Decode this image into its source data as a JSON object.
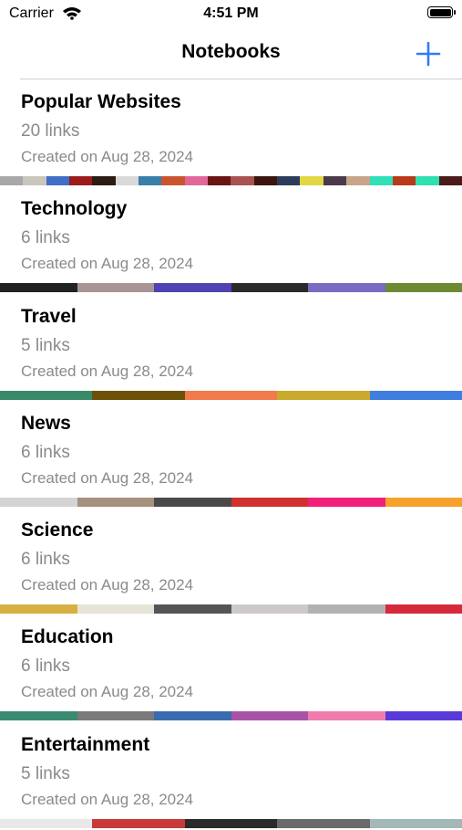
{
  "status_bar": {
    "carrier": "Carrier",
    "time": "4:51 PM"
  },
  "nav": {
    "title": "Notebooks",
    "add_icon": "plus-icon",
    "accent_color": "#2f7cf6"
  },
  "notebooks": [
    {
      "name": "Popular Websites",
      "links": "20 links",
      "created": "Created on Aug 28, 2024",
      "colors": [
        "#a8a8a8",
        "#c9c6be",
        "#3f6fc6",
        "#9b1c1a",
        "#2b1c14",
        "#d9d9d9",
        "#3a7fa8",
        "#c9552f",
        "#e2679a",
        "#6b1512",
        "#a85252",
        "#3d1510",
        "#2b3d5a",
        "#e1d744",
        "#4a3a4a",
        "#c8a48a",
        "#2fe0b8",
        "#b83a1a",
        "#2fe0b0",
        "#4b1a1a"
      ]
    },
    {
      "name": "Technology",
      "links": "6 links",
      "created": "Created on Aug 28, 2024",
      "colors": [
        "#222222",
        "#a89494",
        "#4f42b2",
        "#2a2a2a",
        "#7a6ac2",
        "#6c8a32"
      ]
    },
    {
      "name": "Travel",
      "links": "5 links",
      "created": "Created on Aug 28, 2024",
      "colors": [
        "#3a8a6a",
        "#6c5208",
        "#f27a4a",
        "#c8aa2c",
        "#3f7ee0"
      ]
    },
    {
      "name": "News",
      "links": "6 links",
      "created": "Created on Aug 28, 2024",
      "colors": [
        "#d4d4d4",
        "#a6907e",
        "#4a4a4a",
        "#d03030",
        "#f0207a",
        "#f6a22a"
      ]
    },
    {
      "name": "Science",
      "links": "6 links",
      "created": "Created on Aug 28, 2024",
      "colors": [
        "#d6b040",
        "#e6e4d6",
        "#555555",
        "#ccc8cc",
        "#b2b2b2",
        "#d62a3c"
      ]
    },
    {
      "name": "Education",
      "links": "6 links",
      "created": "Created on Aug 28, 2024",
      "colors": [
        "#3a8a72",
        "#7a7a7a",
        "#3a6ab0",
        "#a854a6",
        "#f07cae",
        "#5a3ad8"
      ]
    },
    {
      "name": "Entertainment",
      "links": "5 links",
      "created": "Created on Aug 28, 2024",
      "colors": [
        "#e8e8e8",
        "#c83a3a",
        "#2a2a2a",
        "#6a6a6a",
        "#a4b8b8"
      ]
    }
  ]
}
